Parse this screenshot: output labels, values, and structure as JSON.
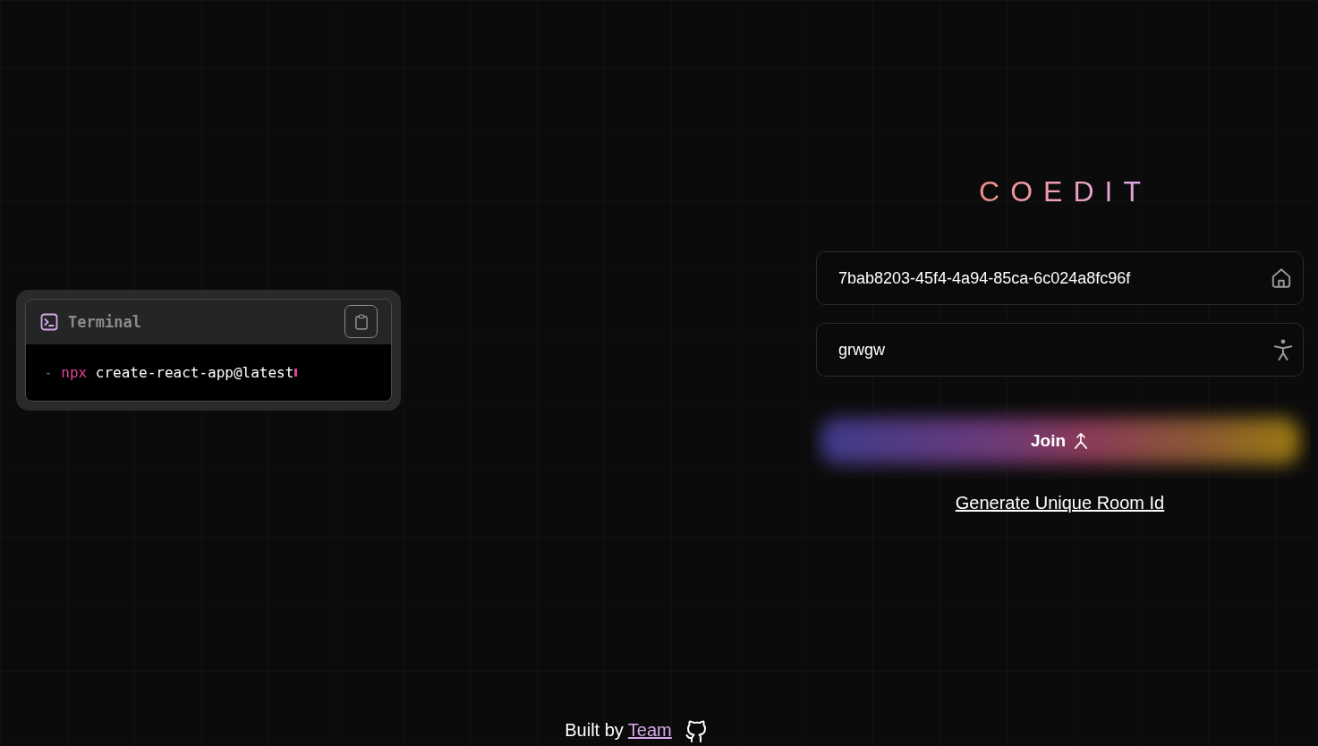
{
  "terminal": {
    "title": "Terminal",
    "prompt": "-",
    "command": "npx",
    "argument": "create-react-app@latest"
  },
  "logo": "COEDIT",
  "room_id_field": {
    "value": "7bab8203-45f4-4a94-85ca-6c024a8fc96f"
  },
  "username_field": {
    "value": "grwgw"
  },
  "join_button": {
    "label": "Join"
  },
  "generate_link": "Generate Unique Room Id",
  "footer": {
    "text": "Built by",
    "link": "Team"
  }
}
